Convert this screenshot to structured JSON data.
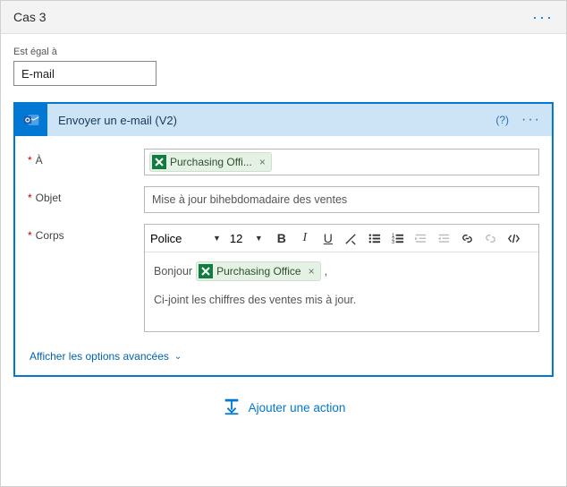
{
  "case_title": "Cas 3",
  "equals_label": "Est égal à",
  "equals_value": "E-mail",
  "action": {
    "title": "Envoyer un e-mail (V2)",
    "help_label": "(?)",
    "fields": {
      "to_label": "À",
      "to_token": "Purchasing Offi...",
      "subject_label": "Objet",
      "subject_value": "Mise à jour bihebdomadaire des ventes",
      "body_label": "Corps",
      "font_label": "Police",
      "font_size": "12",
      "body_greeting": "Bonjour",
      "body_token": "Purchasing Office",
      "body_punct": ",",
      "body_line2": "Ci-joint les chiffres des ventes mis à jour."
    },
    "advanced_label": "Afficher les options avancées"
  },
  "add_action_label": "Ajouter une action"
}
